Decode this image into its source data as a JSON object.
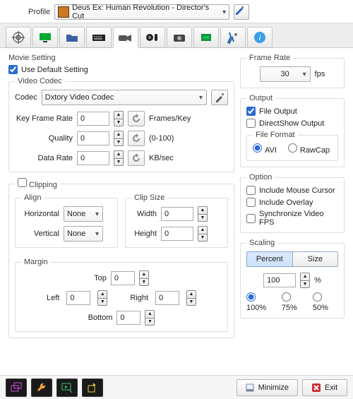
{
  "profile": {
    "label": "Profile",
    "selected": "Deus Ex: Human Revolution - Director's Cut"
  },
  "movie": {
    "section": "Movie Setting",
    "use_default": {
      "label": "Use Default Setting",
      "checked": true
    },
    "video_codec": {
      "legend": "Video Codec",
      "label": "Codec",
      "selected": "Dxtory Video Codec",
      "key_frame_rate": {
        "label": "Key Frame Rate",
        "value": "0",
        "suffix": "Frames/Key"
      },
      "quality": {
        "label": "Quality",
        "value": "0",
        "suffix": "(0-100)"
      },
      "data_rate": {
        "label": "Data Rate",
        "value": "0",
        "suffix": "KB/sec"
      }
    },
    "clipping": {
      "legend": "Clipping",
      "checked": false,
      "align": {
        "legend": "Align",
        "h_label": "Horizontal",
        "h_value": "None",
        "v_label": "Vertical",
        "v_value": "None"
      },
      "clipsize": {
        "legend": "Clip Size",
        "w_label": "Width",
        "w_value": "0",
        "h_label": "Height",
        "h_value": "0"
      },
      "margin": {
        "legend": "Margin",
        "top": {
          "label": "Top",
          "value": "0"
        },
        "left": {
          "label": "Left",
          "value": "0"
        },
        "right": {
          "label": "Right",
          "value": "0"
        },
        "bottom": {
          "label": "Bottom",
          "value": "0"
        }
      }
    }
  },
  "frame_rate": {
    "legend": "Frame Rate",
    "value": "30",
    "unit": "fps"
  },
  "output": {
    "legend": "Output",
    "file_output": {
      "label": "File Output",
      "checked": true
    },
    "directshow": {
      "label": "DirectShow Output",
      "checked": false
    },
    "file_format": {
      "legend": "File Format",
      "avi": {
        "label": "AVI",
        "checked": true
      },
      "rawcap": {
        "label": "RawCap",
        "checked": false
      }
    }
  },
  "option": {
    "legend": "Option",
    "mouse": {
      "label": "Include Mouse Cursor",
      "checked": false
    },
    "overlay": {
      "label": "Include Overlay",
      "checked": false
    },
    "sync": {
      "label": "Synchronize Video FPS",
      "checked": false
    }
  },
  "scaling": {
    "legend": "Scaling",
    "percent_tab": "Percent",
    "size_tab": "Size",
    "value": "100",
    "unit": "%",
    "presets": {
      "p100": "100%",
      "p75": "75%",
      "p50": "50%"
    }
  },
  "footer": {
    "minimize": "Minimize",
    "exit": "Exit"
  }
}
